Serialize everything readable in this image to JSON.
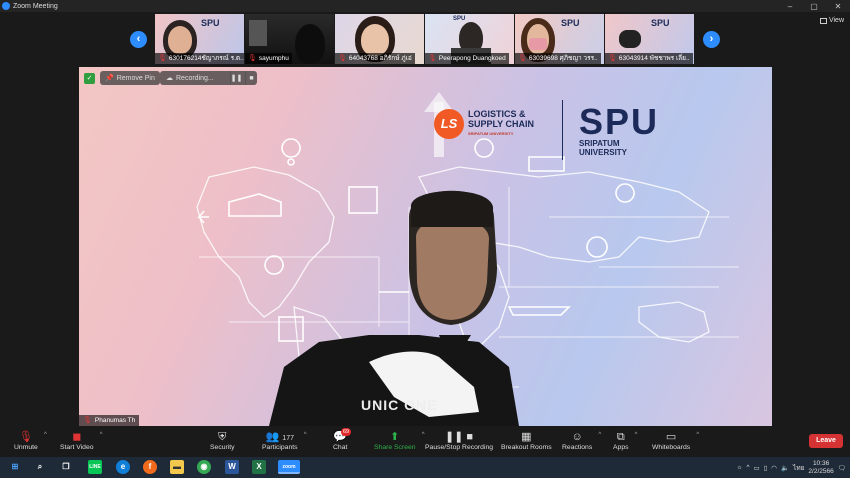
{
  "window": {
    "title": "Zoom Meeting",
    "min": "–",
    "max": "▢",
    "close": "✕"
  },
  "view_button": {
    "label": "View"
  },
  "thumbnails": [
    {
      "name": "630176214ชัญาภรณ์ ร.ต..",
      "mic_muted": true
    },
    {
      "name": "sayumphu",
      "mic_muted": true
    },
    {
      "name": "64043768 อภิรักษ์ ภู่เอ่",
      "mic_muted": true
    },
    {
      "name": "Peerapong Duangkoed",
      "mic_muted": true
    },
    {
      "name": "63039698 ศุภิชญา วรร..",
      "mic_muted": true
    },
    {
      "name": "63043914 พัชชาพร เลี่ย..",
      "mic_muted": true
    }
  ],
  "main_video": {
    "remove_pin": "Remove Pin",
    "recording": "Recording...",
    "speaker_name": "Phanumas Th",
    "logo_ls": "LS",
    "logo_line1": "LOGISTICS &",
    "logo_line2": "SUPPLY CHAIN",
    "logo_line3": "SRIPATUM UNIVERSITY",
    "spu_big": "SPU",
    "spu_line1": "SRIPATUM",
    "spu_line2": "UNIVERSITY",
    "shirt_text": "UNIC   ONE"
  },
  "toolbar": {
    "unmute": "Unmute",
    "start_video": "Start Video",
    "security": "Security",
    "participants": "Participants",
    "participants_count": "177",
    "chat": "Chat",
    "chat_badge": "69",
    "share_screen": "Share Screen",
    "pause_recording": "Pause/Stop Recording",
    "breakout": "Breakout Rooms",
    "reactions": "Reactions",
    "apps": "Apps",
    "whiteboards": "Whiteboards",
    "leave": "Leave"
  },
  "taskbar": {
    "lang": "ไทย",
    "time": "10:36",
    "date": "2/2/2566",
    "apps": [
      "LINE",
      "Edge",
      "Firefox",
      "Files",
      "Chrome",
      "Word",
      "Excel",
      "Zoom"
    ]
  },
  "colors": {
    "accent": "#2d8cff",
    "leave": "#d53333",
    "share": "#2fb14a",
    "muted": "#e03434"
  }
}
